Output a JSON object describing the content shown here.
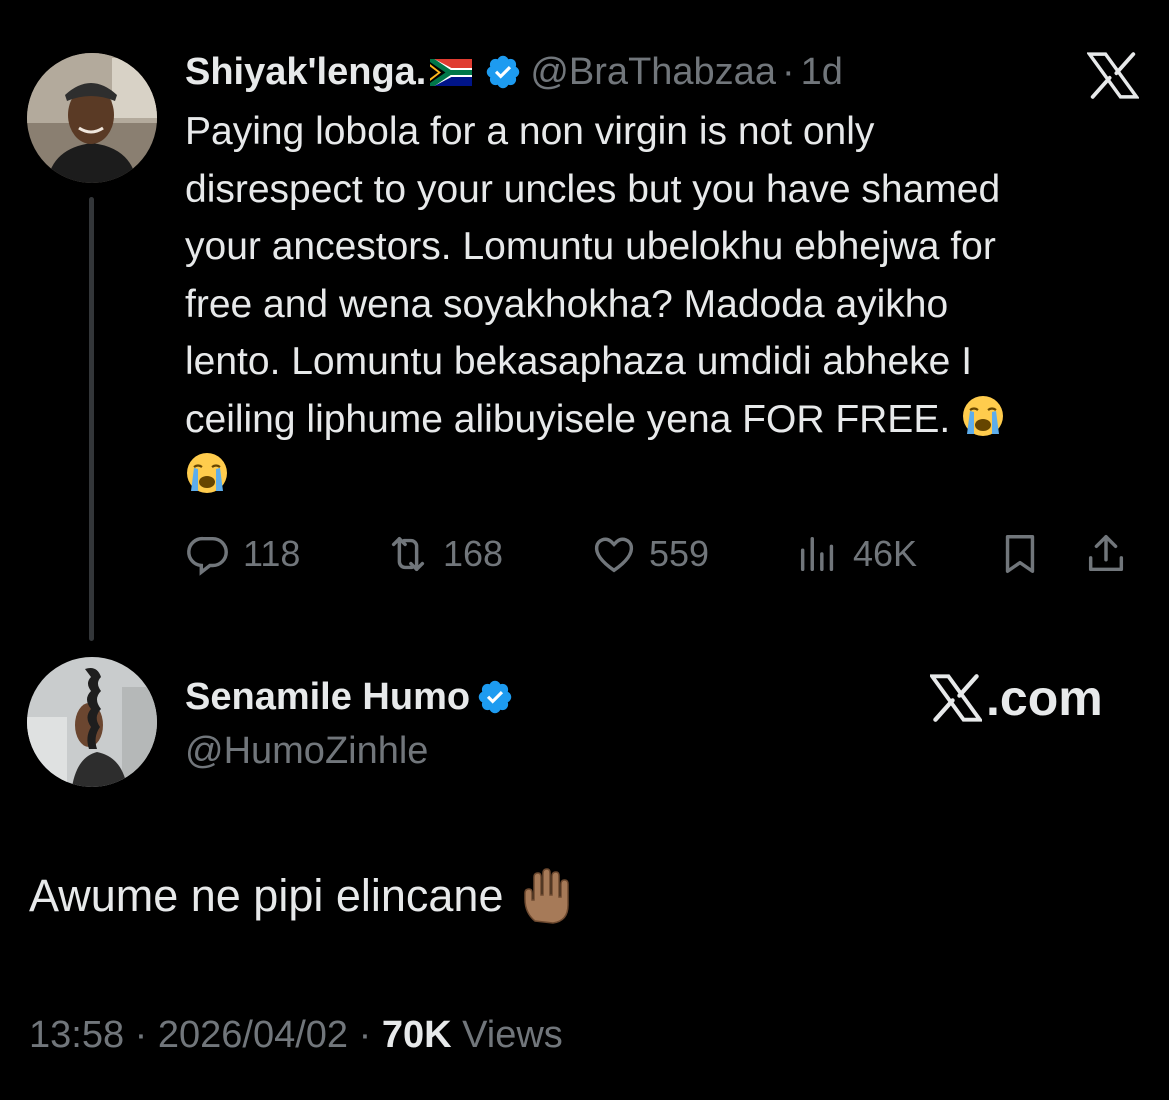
{
  "original_tweet": {
    "author_name": "Shiyak'lenga.",
    "flag_emoji": "south-africa-flag",
    "handle": "@BraThabzaa",
    "time_ago": "1d",
    "text_lines": [
      "Paying lobola for a non virgin is not only",
      "disrespect to your uncles but you have shamed",
      "your ancestors. Lomuntu ubelokhu ebhejwa for",
      "free and wena soyakhokha? Madoda ayikho",
      "lento. Lomuntu bekasaphaza umdidi abheke I",
      "ceiling liphume alibuyisele yena FOR FREE."
    ],
    "emoji": "loudly-crying-face-emoji",
    "stats": {
      "replies": "118",
      "reposts": "168",
      "likes": "559",
      "views": "46K"
    }
  },
  "reply_tweet": {
    "author_name": "Senamile Humo",
    "handle": "@HumoZinhle",
    "text": "Awume ne pipi elincane",
    "emoji": "raised-hand-emoji",
    "time": "13:58",
    "date": "2026/04/02",
    "views_count": "70K",
    "views_label": "Views"
  },
  "watermark": ".com",
  "colors": {
    "background": "#000000",
    "text": "#e7e9ea",
    "secondary": "#71767b",
    "verified": "#1d9bf0"
  }
}
